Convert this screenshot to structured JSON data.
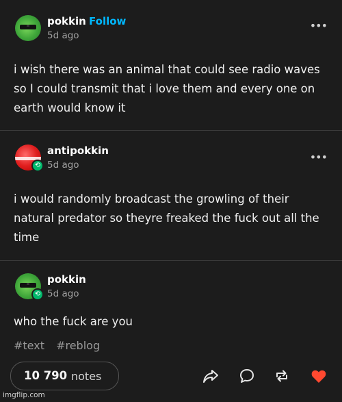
{
  "posts": [
    {
      "username": "pokkin",
      "follow_label": "Follow",
      "time": "5d ago",
      "text": "i wish there was an animal that could see radio waves so I could transmit that i love them and every one on earth would know it",
      "avatar_color": "#3fa63a"
    },
    {
      "username": "antipokkin",
      "time": "5d ago",
      "text": "i would randomly broadcast the growling of their natural predator so theyre freaked the fuck out all the time",
      "avatar_color": "#e01f1f"
    },
    {
      "username": "pokkin",
      "time": "5d ago",
      "text": "who the fuck are you",
      "avatar_color": "#3fa63a"
    }
  ],
  "tags": [
    "#text",
    "#reblog"
  ],
  "notes": {
    "count": "10 790",
    "label": "notes"
  },
  "actions": [
    "share-icon",
    "reply-icon",
    "reblog-icon",
    "like-icon"
  ],
  "menu_icon": "more-dots-icon",
  "colors": {
    "accent": "#00b8ff",
    "like": "#ff4930",
    "reblog_badge": "#00b86b"
  },
  "watermark": "imgflip.com"
}
